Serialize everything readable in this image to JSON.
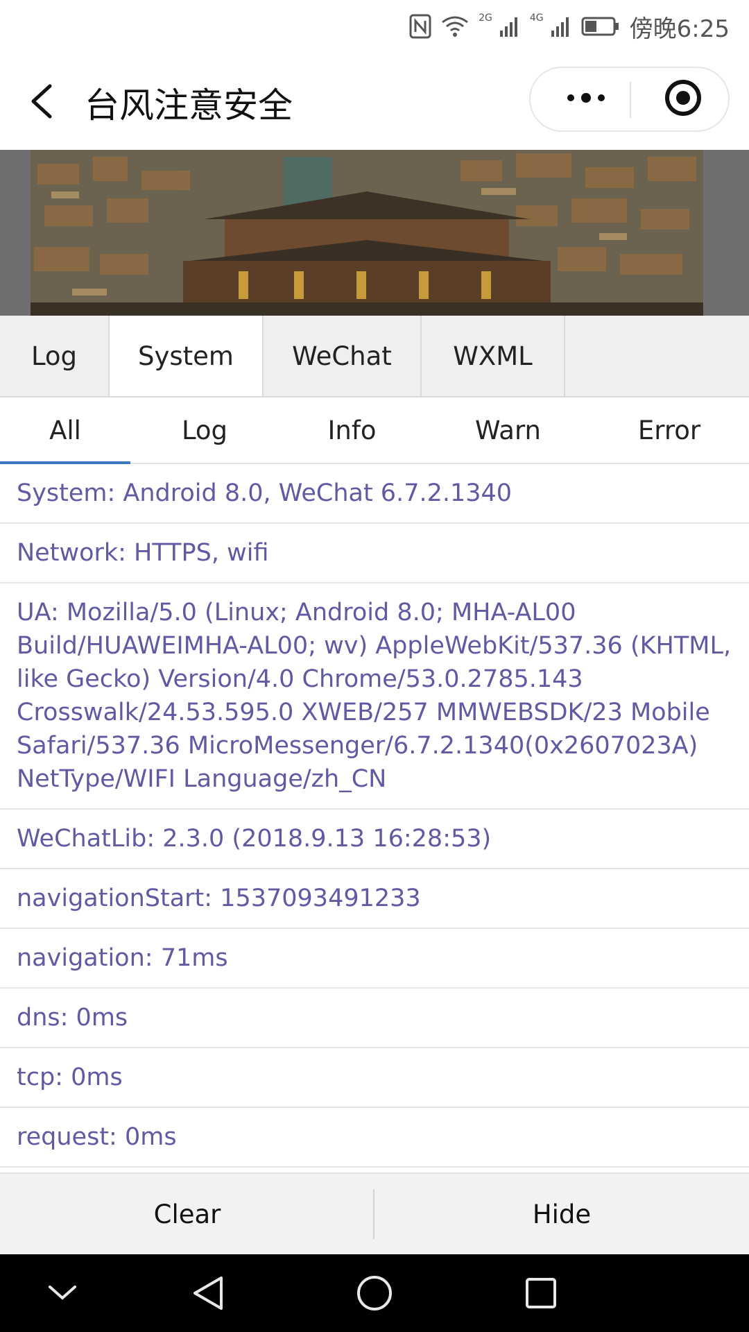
{
  "status_bar": {
    "time": "傍晚6:25",
    "network_1": "2G",
    "network_2": "4G",
    "icons": [
      "nfc-icon",
      "wifi-icon",
      "signal-icon",
      "signal-icon",
      "battery-icon"
    ]
  },
  "nav": {
    "title": "台风注意安全",
    "back_icon": "chevron-left-icon",
    "more_icon": "more-dots-icon",
    "close_icon": "target-close-icon"
  },
  "main_tabs": [
    {
      "label": "Log",
      "active": false
    },
    {
      "label": "System",
      "active": true
    },
    {
      "label": "WeChat",
      "active": false
    },
    {
      "label": "WXML",
      "active": false
    }
  ],
  "sub_tabs": [
    {
      "label": "All",
      "active": true
    },
    {
      "label": "Log",
      "active": false
    },
    {
      "label": "Info",
      "active": false
    },
    {
      "label": "Warn",
      "active": false
    },
    {
      "label": "Error",
      "active": false
    }
  ],
  "logs": [
    "System: Android 8.0, WeChat 6.7.2.1340",
    "Network: HTTPS, wifi",
    "UA: Mozilla/5.0 (Linux; Android 8.0; MHA-AL00 Build/HUAWEIMHA-AL00; wv) AppleWebKit/537.36 (KHTML, like Gecko) Version/4.0 Chrome/53.0.2785.143 Crosswalk/24.53.595.0 XWEB/257 MMWEBSDK/23 Mobile Safari/537.36 MicroMessenger/6.7.2.1340(0x2607023A) NetType/WIFI Language/zh_CN",
    "WeChatLib: 2.3.0 (2018.9.13 16:28:53)",
    "navigationStart: 1537093491233",
    "navigation: 71ms",
    "dns: 0ms",
    "tcp: 0ms",
    "request: 0ms"
  ],
  "bottom": {
    "clear_label": "Clear",
    "hide_label": "Hide"
  },
  "colors": {
    "log_text": "#5f5aa2",
    "active_underline": "#3b78c4",
    "tab_bg": "#efefef"
  }
}
